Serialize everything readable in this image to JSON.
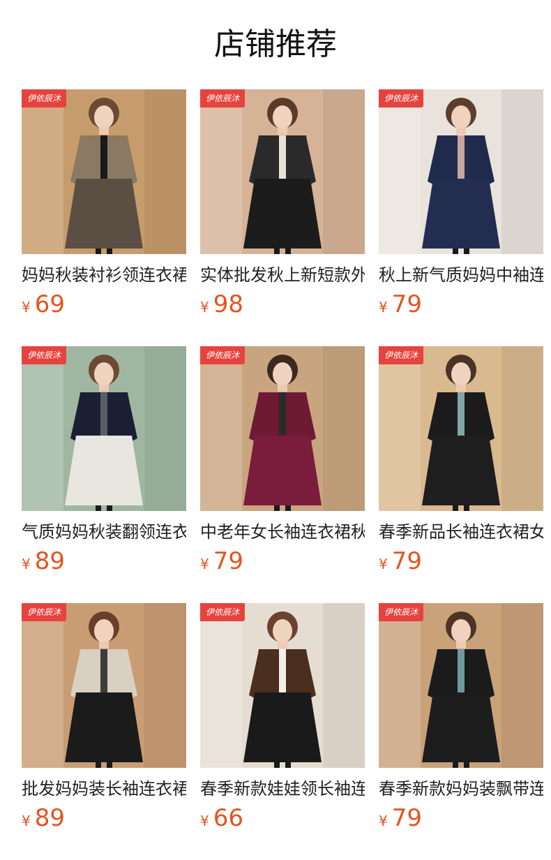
{
  "page_title": "店铺推荐",
  "currency_symbol": "¥",
  "colors": {
    "price": "#e4541f",
    "badge": "#e7433e"
  },
  "products": [
    {
      "brand": "伊依辰沐",
      "name": "妈妈秋装衬衫领连衣裙",
      "price": "69",
      "photo": "leopard-print-dress",
      "bg": "#c79c6c",
      "top": "#8a7a64",
      "skirt": "#5b4f44",
      "accent": "#1a1a1a",
      "hair": "#6b4a33"
    },
    {
      "brand": "伊依辰沐",
      "name": "实体批发秋上新短款外套",
      "price": "98",
      "photo": "tweed-jacket",
      "bg": "#d6b396",
      "top": "#2a2a2a",
      "skirt": "#1c1c1c",
      "accent": "#e8e0d4",
      "hair": "#5a3b28"
    },
    {
      "brand": "伊依辰沐",
      "name": "秋上新气质妈妈中袖连衣裙",
      "price": "79",
      "photo": "navy-dress",
      "bg": "#e9e3dc",
      "top": "#1f2a4d",
      "skirt": "#232d52",
      "accent": "#c8a6a0",
      "hair": "#5b3e2b"
    },
    {
      "brand": "伊依辰沐",
      "name": "气质妈妈秋装翻领连衣裙",
      "price": "89",
      "photo": "colorblock-dress",
      "bg": "#9fb7a0",
      "top": "#1a1f33",
      "skirt": "#e8e6df",
      "accent": "#5a5d66",
      "hair": "#6e4a34"
    },
    {
      "brand": "伊依辰沐",
      "name": "中老年女长袖连衣裙秋",
      "price": "79",
      "photo": "burgundy-lace-dress",
      "bg": "#c9a57f",
      "top": "#6e1a34",
      "skirt": "#7a1d3c",
      "accent": "#2b2b2b",
      "hair": "#3c2a1f"
    },
    {
      "brand": "伊依辰沐",
      "name": "春季新品长袖连衣裙女",
      "price": "79",
      "photo": "floral-sleeve-dress",
      "bg": "#d9b98f",
      "top": "#1b1b1b",
      "skirt": "#1e1e1e",
      "accent": "#7fa6a6",
      "hair": "#4a3326"
    },
    {
      "brand": "伊依辰沐",
      "name": "批发妈妈装长袖连衣裙",
      "price": "89",
      "photo": "pattern-jacket-dress",
      "bg": "#c89d74",
      "top": "#d8d0c0",
      "skirt": "#1b1b1b",
      "accent": "#3d3d3d",
      "hair": "#6a3f2a"
    },
    {
      "brand": "伊依辰沐",
      "name": "春季新款娃娃领长袖连衣裙",
      "price": "66",
      "photo": "brown-velvet-dress",
      "bg": "#e6ddd2",
      "top": "#4a2e1e",
      "skirt": "#1a1a1a",
      "accent": "#f2efe8",
      "hair": "#6b4230"
    },
    {
      "brand": "伊依辰沐",
      "name": "春季新款妈妈装飘带连衣裙",
      "price": "79",
      "photo": "bow-floral-dress",
      "bg": "#c9a27a",
      "top": "#1b1b1b",
      "skirt": "#1d1d1d",
      "accent": "#6f9a9c",
      "hair": "#4e3426"
    }
  ]
}
